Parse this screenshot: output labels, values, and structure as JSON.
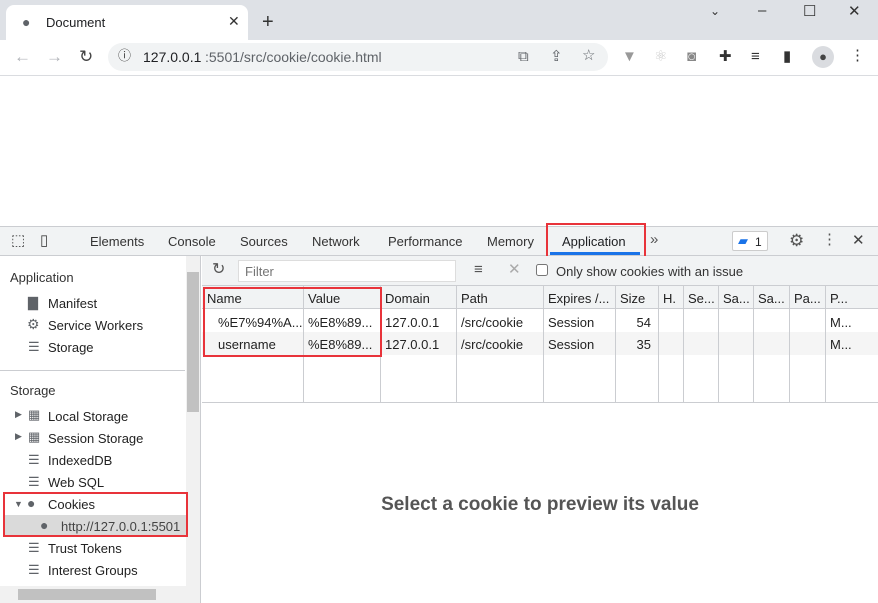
{
  "browser": {
    "tab_title": "Document",
    "url_host": "127.0.0.1",
    "url_rest": ":5501/src/cookie/cookie.html"
  },
  "devtools": {
    "tabs": [
      "Elements",
      "Console",
      "Sources",
      "Network",
      "Performance",
      "Memory",
      "Application"
    ],
    "active_tab": "Application",
    "issues_count": "1",
    "sidebar": {
      "application_header": "Application",
      "application_items": [
        "Manifest",
        "Service Workers",
        "Storage"
      ],
      "storage_header": "Storage",
      "storage_items": [
        "Local Storage",
        "Session Storage",
        "IndexedDB",
        "Web SQL",
        "Cookies"
      ],
      "cookie_origin": "http://127.0.0.1:5501",
      "more_items": [
        "Trust Tokens",
        "Interest Groups"
      ]
    },
    "cookies": {
      "filter_placeholder": "Filter",
      "only_issues_label": "Only show cookies with an issue",
      "only_issues_checked": false,
      "columns": [
        "Name",
        "Value",
        "Domain",
        "Path",
        "Expires /...",
        "Size",
        "H.",
        "Se...",
        "Sa...",
        "Sa...",
        "Pa...",
        "P..."
      ],
      "rows": [
        [
          "%E7%94%A...",
          "%E8%89...",
          "127.0.0.1",
          "/src/cookie",
          "Session",
          "54",
          "",
          "",
          "",
          "",
          "",
          "M..."
        ],
        [
          "username",
          "%E8%89...",
          "127.0.0.1",
          "/src/cookie",
          "Session",
          "35",
          "",
          "",
          "",
          "",
          "",
          "M..."
        ]
      ],
      "preview_text": "Select a cookie to preview its value"
    }
  },
  "colors": {
    "highlight": "#e8333a",
    "accent": "#1a73e8"
  }
}
